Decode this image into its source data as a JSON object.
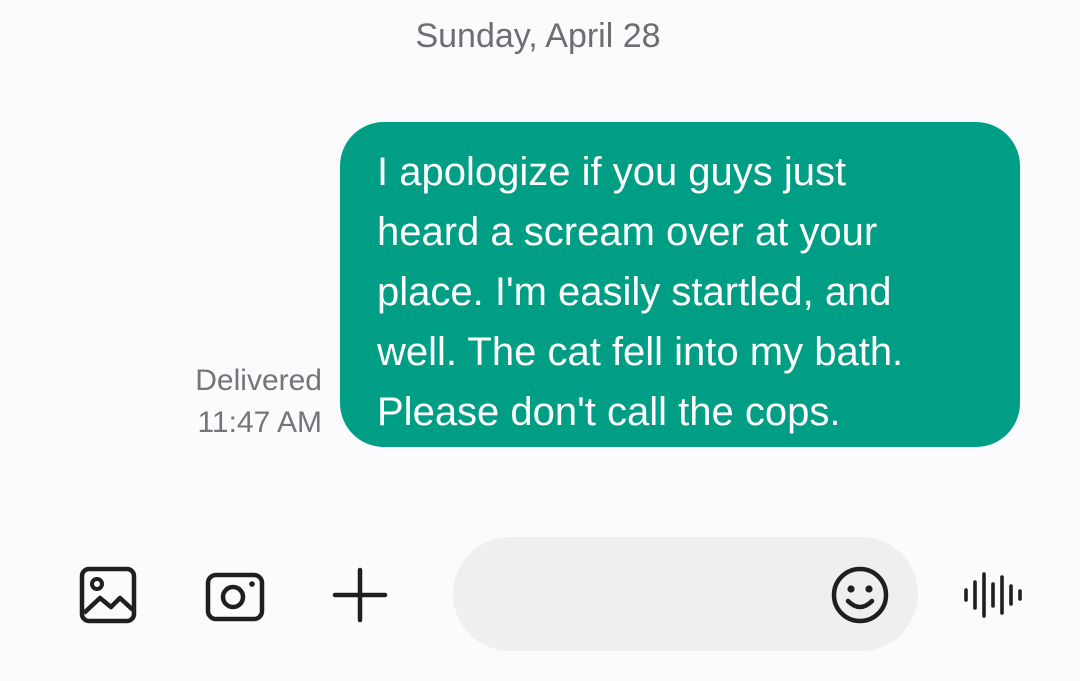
{
  "conversation": {
    "date_header": "Sunday, April 28",
    "message": {
      "text": "I apologize if you guys just\nheard a scream over at your\nplace. I'm easily startled, and\nwell. The cat fell into my bath.\nPlease don't call the cops.",
      "status": "Delivered",
      "time": "11:47 AM"
    }
  },
  "composer": {
    "input_value": "",
    "input_placeholder": "",
    "icons": [
      "gallery-icon",
      "camera-icon",
      "plus-icon",
      "emoji-icon",
      "voice-icon"
    ]
  },
  "colors": {
    "bubble": "#009e84",
    "bubble_text": "#ffffff",
    "background": "#fbfbfe",
    "input_background": "#efeff1",
    "secondary_text": "#757579",
    "icon": "#1f1f1f"
  }
}
